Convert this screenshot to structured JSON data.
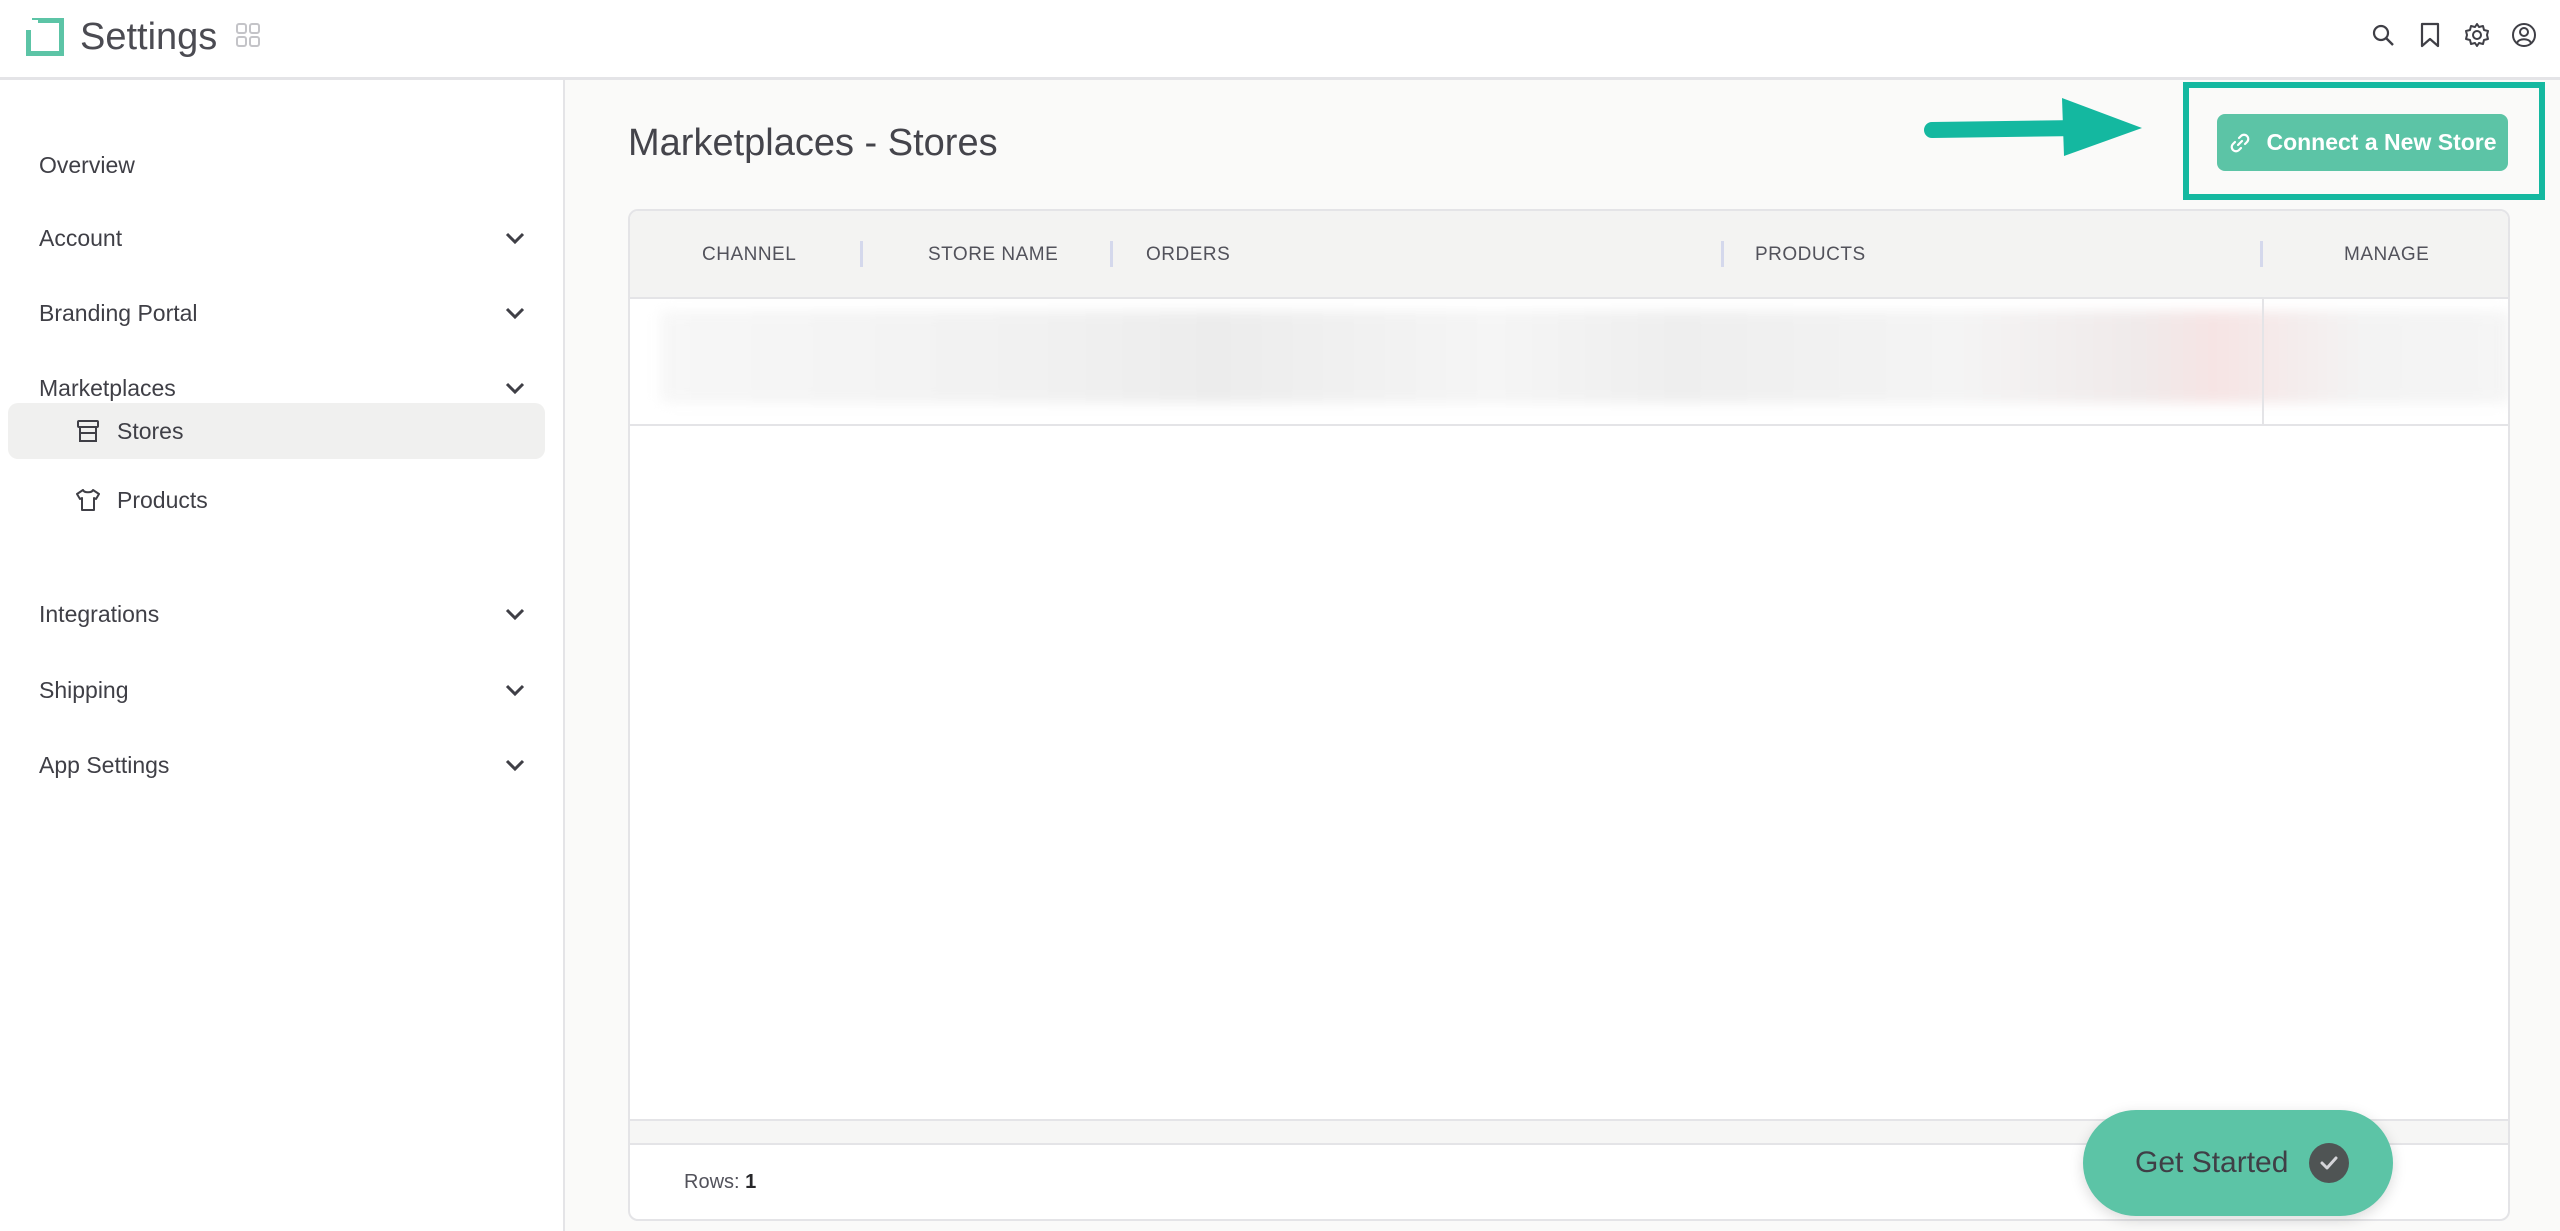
{
  "header": {
    "title": "Settings",
    "icons": [
      "search-icon",
      "bookmark-icon",
      "gear-icon",
      "user-circle-icon"
    ]
  },
  "sidebar": {
    "items": [
      {
        "label": "Overview"
      },
      {
        "label": "Account"
      },
      {
        "label": "Branding Portal"
      },
      {
        "label": "Marketplaces"
      },
      {
        "label": "Stores"
      },
      {
        "label": "Products"
      },
      {
        "label": "Integrations"
      },
      {
        "label": "Shipping"
      },
      {
        "label": "App Settings"
      }
    ]
  },
  "main": {
    "page_title": "Marketplaces - Stores",
    "connect_button": "Connect a New Store",
    "table": {
      "columns": [
        "CHANNEL",
        "STORE NAME",
        "ORDERS",
        "PRODUCTS",
        "MANAGE"
      ],
      "rows_label": "Rows:",
      "rows_count": "1"
    },
    "get_started": "Get Started"
  },
  "colors": {
    "accent": "#5cc4a6",
    "highlight": "#14b8a0",
    "active_nav": "#f0f0ef"
  }
}
